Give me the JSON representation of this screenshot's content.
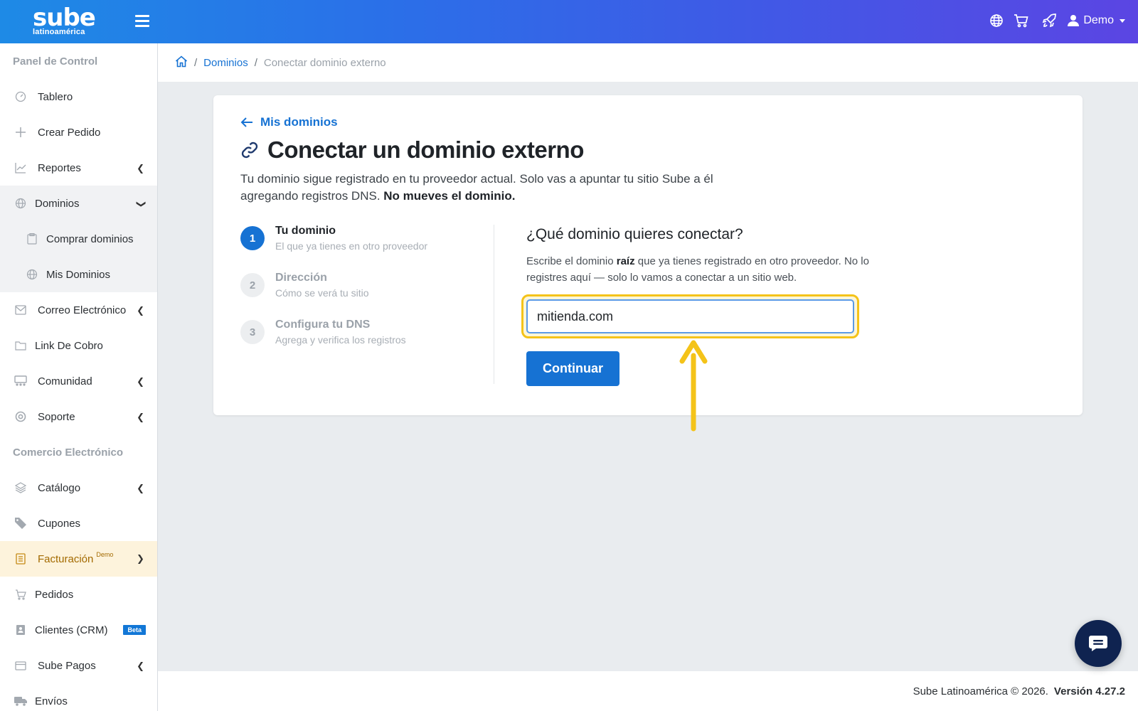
{
  "header": {
    "logo_word": "sube",
    "logo_sub": "latinoamérica",
    "user_label": "Demo",
    "icons": [
      "globe-icon",
      "cart-icon",
      "rocket-icon",
      "user-icon"
    ]
  },
  "sidebar": {
    "section_panel": "Panel de Control",
    "section_ecommerce": "Comercio Electrónico",
    "items": {
      "tablero": "Tablero",
      "crear_pedido": "Crear Pedido",
      "reportes": "Reportes",
      "dominios": "Dominios",
      "comprar_dominios": "Comprar dominios",
      "mis_dominios": "Mis Dominios",
      "correo": "Correo Electrónico",
      "link_cobro": "Link De Cobro",
      "comunidad": "Comunidad",
      "soporte": "Soporte",
      "catalogo": "Catálogo",
      "cupones": "Cupones",
      "facturacion": "Facturación",
      "facturacion_tag": "Demo",
      "pedidos": "Pedidos",
      "clientes": "Clientes (CRM)",
      "clientes_badge": "Beta",
      "sube_pagos": "Sube Pagos",
      "envios": "Envíos"
    }
  },
  "breadcrumb": {
    "dominios": "Dominios",
    "current": "Conectar dominio externo"
  },
  "card": {
    "back_label": "Mis dominios",
    "title": "Conectar un dominio externo",
    "desc_text": "Tu dominio sigue registrado en tu proveedor actual. Solo vas a apuntar tu sitio Sube a él agregando registros DNS.",
    "desc_bold": "No mueves el dominio.",
    "steps": [
      {
        "num": "1",
        "title": "Tu dominio",
        "subtitle": "El que ya tienes en otro proveedor"
      },
      {
        "num": "2",
        "title": "Dirección",
        "subtitle": "Cómo se verá tu sitio"
      },
      {
        "num": "3",
        "title": "Configura tu DNS",
        "subtitle": "Agrega y verifica los registros"
      }
    ],
    "form": {
      "heading": "¿Qué dominio quieres conectar?",
      "help_pre": "Escribe el dominio",
      "help_bold": "raíz",
      "help_post": "que ya tienes registrado en otro proveedor. No lo registres aquí — solo lo vamos a conectar a un sitio web.",
      "input_value": "mitienda.com",
      "button_label": "Continuar"
    }
  },
  "footer": {
    "copyright": "Sube Latinoamérica © 2026.",
    "version": "Versión 4.27.2"
  },
  "colors": {
    "primary": "#1672d3",
    "highlight": "#f4c319",
    "active_bg": "#fdf3dc"
  }
}
